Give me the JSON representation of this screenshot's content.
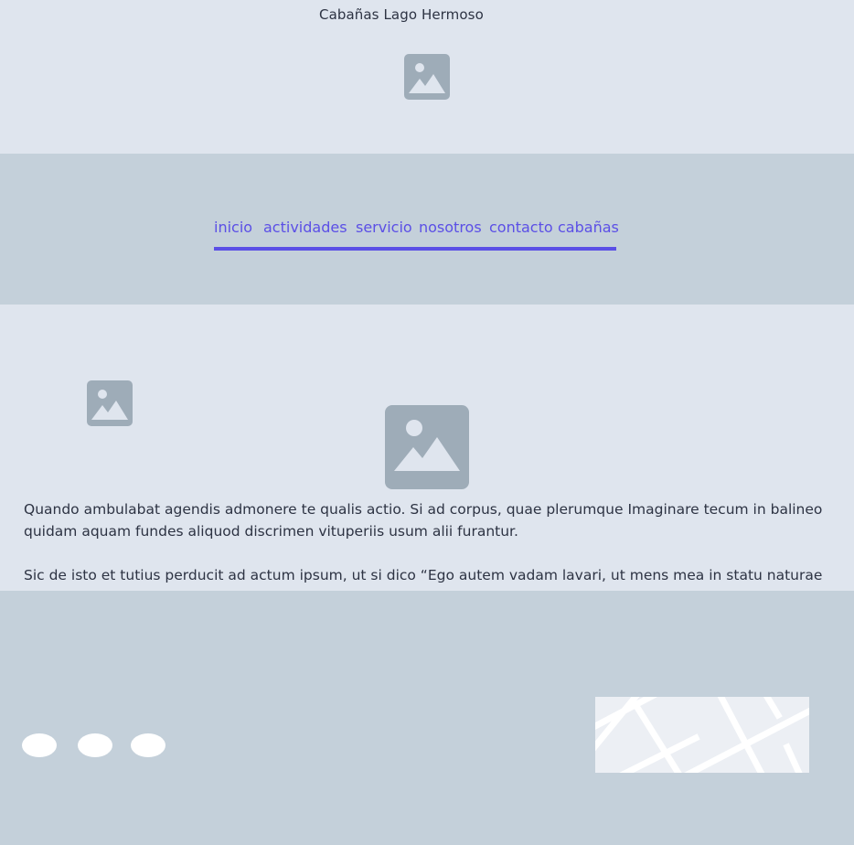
{
  "header": {
    "site_title": "Cabañas Lago Hermoso",
    "logo_icon": "image-placeholder-icon"
  },
  "nav": {
    "accent_color": "#5b4fe6",
    "items": [
      {
        "label": "inicio"
      },
      {
        "label": "actividades"
      },
      {
        "label": "servicio"
      },
      {
        "label": "nosotros"
      },
      {
        "label": "contacto"
      },
      {
        "label": "cabañas"
      }
    ]
  },
  "content": {
    "small_image_icon": "image-placeholder-icon",
    "main_image_icon": "image-placeholder-icon",
    "paragraphs": [
      "Quando ambulabat agendis admonere te qualis actio. Si ad corpus, quae plerumque Imaginare tecum in balineo quidam aquam fundes aliquod discrimen vituperiis usum alii furantur.",
      "Sic de isto et tutius perducit ad actum ipsum, ut si dico “Ego autem vadam lavari, ut mens mea in statu naturae"
    ]
  },
  "footer": {
    "social_icons": [
      "social-icon",
      "social-icon",
      "social-icon"
    ],
    "map_icon": "map-placeholder"
  },
  "colors": {
    "background_light": "#dfe5ee",
    "background_band": "#c4d0da",
    "placeholder_gray": "#9eacb8",
    "text": "#2d3343"
  }
}
